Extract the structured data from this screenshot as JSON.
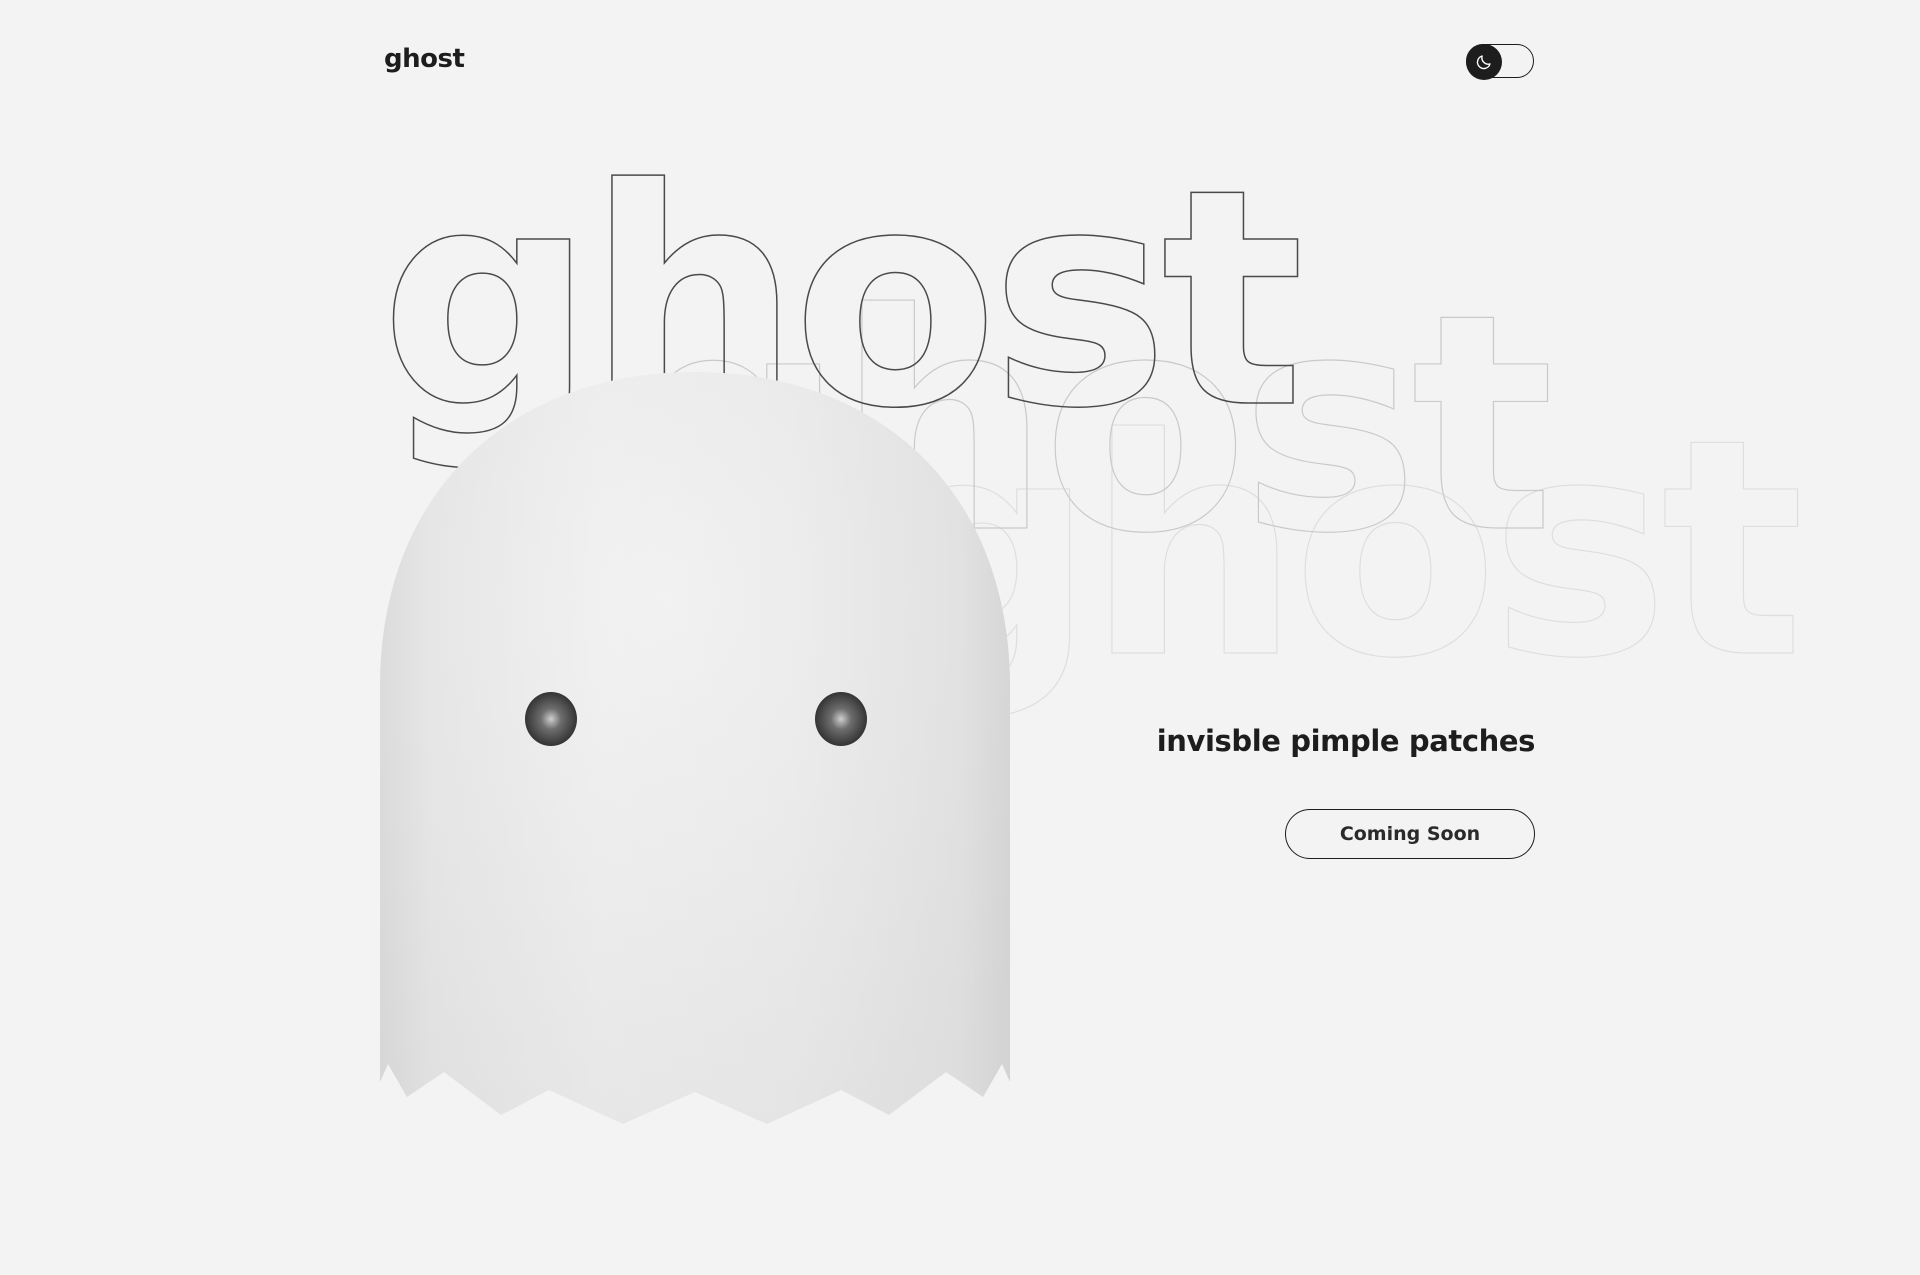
{
  "header": {
    "logo": "ghost",
    "theme_toggle_icon": "moon-icon"
  },
  "hero": {
    "outline_words": [
      "ghost",
      "ghost",
      "ghost"
    ],
    "tagline": "invisble pimple patches",
    "cta_label": "Coming Soon"
  },
  "colors": {
    "background": "#f3f3f3",
    "text": "#1d1d1d",
    "ghost_body": "#ebebeb",
    "ghost_eye": "#3a3a3a"
  }
}
